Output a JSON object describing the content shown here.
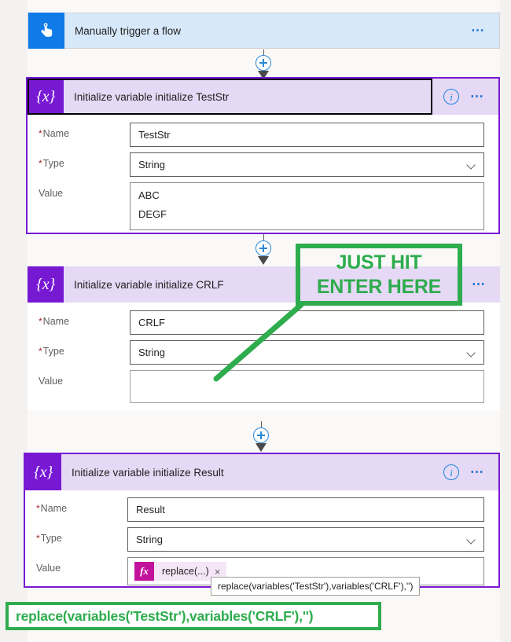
{
  "colors": {
    "variable_accent": "#7719d3",
    "variable_header_bg": "#e6d9f5",
    "trigger_accent": "#0f7ae8",
    "trigger_header_bg": "#d6e8fa",
    "annotation_green": "#2eac4e",
    "token_fx_bg": "#c2119b",
    "required_red": "#a4262c",
    "connector_blue": "#2b88d8",
    "page_bg": "#f3f2f1"
  },
  "trigger": {
    "icon": "tap-hand-icon",
    "title": "Manually trigger a flow",
    "menu": "…"
  },
  "connectors": [
    {
      "name": "connector-1",
      "plus": "+",
      "arrow": "arrow-down-icon"
    },
    {
      "name": "connector-2",
      "plus": "+",
      "arrow": "arrow-down-icon"
    },
    {
      "name": "connector-3",
      "plus": "+",
      "arrow": "arrow-down-icon"
    }
  ],
  "cards": [
    {
      "id": "teststr",
      "icon": "variable-braces-icon",
      "title": "Initialize variable initialize TestStr",
      "selected": true,
      "info_icon": "i",
      "menu": "…",
      "fields": {
        "name": {
          "label": "Name",
          "required": true,
          "value": "TestStr"
        },
        "type": {
          "label": "Type",
          "required": true,
          "value": "String",
          "chevron": "chevron-down-icon"
        },
        "value": {
          "label": "Value",
          "required": false,
          "lines": [
            "ABC",
            "DEGF"
          ]
        }
      }
    },
    {
      "id": "crlf",
      "icon": "variable-braces-icon",
      "title": "Initialize variable initialize CRLF",
      "selected": false,
      "info_icon": "",
      "menu": "…",
      "fields": {
        "name": {
          "label": "Name",
          "required": true,
          "value": "CRLF"
        },
        "type": {
          "label": "Type",
          "required": true,
          "value": "String",
          "chevron": "chevron-down-icon"
        },
        "value": {
          "label": "Value",
          "required": false,
          "lines": []
        }
      }
    },
    {
      "id": "result",
      "icon": "variable-braces-icon",
      "title": "Initialize variable initialize Result",
      "selected": true,
      "info_icon": "i",
      "menu": "…",
      "fields": {
        "name": {
          "label": "Name",
          "required": true,
          "value": "Result"
        },
        "type": {
          "label": "Type",
          "required": true,
          "value": "String",
          "chevron": "chevron-down-icon"
        },
        "value": {
          "label": "Value",
          "required": false,
          "token": {
            "fx": "fx",
            "label": "replace(...)",
            "remove": "×"
          }
        }
      }
    }
  ],
  "tooltip": {
    "text": "replace(variables('TestStr'),variables('CRLF'),'')"
  },
  "annotations": {
    "callout": {
      "line1": "JUST HIT",
      "line2": "ENTER HERE"
    },
    "expression": {
      "text": "replace(variables('TestStr'),variables('CRLF'),'')"
    }
  }
}
